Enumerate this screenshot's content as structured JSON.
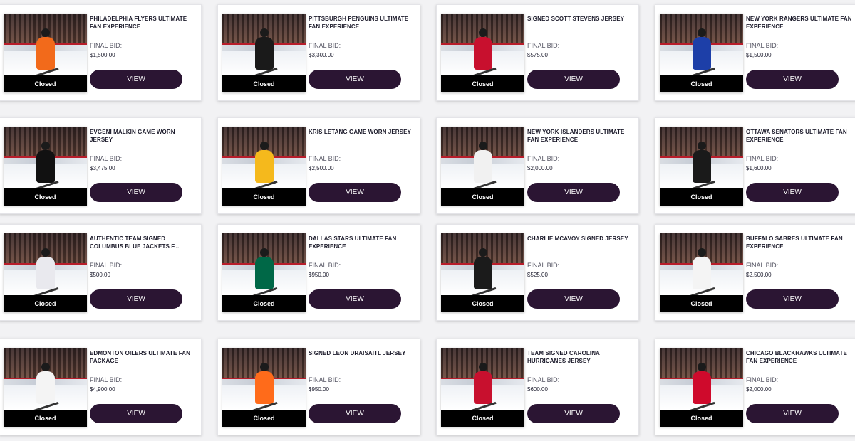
{
  "status_label": "Closed",
  "bid_label": "FINAL BID:",
  "button_label": "VIEW",
  "colors": {
    "button_bg": "#2b1533",
    "status_bg": "#000000",
    "card_bg": "#ffffff"
  },
  "items": [
    {
      "title": "PHILADELPHIA FLYERS ULTIMATE FAN EXPERIENCE",
      "final_bid": "$1,500.00",
      "jersey": "#f26a1b",
      "bg": "#ffffff"
    },
    {
      "title": "PITTSBURGH PENGUINS ULTIMATE FAN EXPERIENCE",
      "final_bid": "$3,300.00",
      "jersey": "#1a1a1a",
      "bg": "#f2b518"
    },
    {
      "title": "SIGNED SCOTT STEVENS JERSEY",
      "final_bid": "$575.00",
      "jersey": "#c8102e",
      "bg": "#e8e6e2"
    },
    {
      "title": "NEW YORK RANGERS ULTIMATE FAN EXPERIENCE",
      "final_bid": "$1,500.00",
      "jersey": "#1d3fa8",
      "bg": "#ffffff"
    },
    {
      "title": "EVGENI MALKIN GAME WORN JERSEY",
      "final_bid": "$3,475.00",
      "jersey": "#111111",
      "bg": "#f2b518"
    },
    {
      "title": "KRIS LETANG GAME WORN JERSEY",
      "final_bid": "$2,500.00",
      "jersey": "#f5b91c",
      "bg": "#dcdcdc"
    },
    {
      "title": "NEW YORK ISLANDERS ULTIMATE FAN EXPERIENCE",
      "final_bid": "$2,000.00",
      "jersey": "#f1f1f1",
      "bg": "#ffffff"
    },
    {
      "title": "OTTAWA SENATORS ULTIMATE FAN EXPERIENCE",
      "final_bid": "$1,600.00",
      "jersey": "#1a1a1a",
      "bg": "#ffffff"
    },
    {
      "title": "AUTHENTIC TEAM SIGNED COLUMBUS BLUE JACKETS F...",
      "final_bid": "$500.00",
      "jersey": "#e9e9ee",
      "bg": "#ffffff"
    },
    {
      "title": "DALLAS STARS ULTIMATE FAN EXPERIENCE",
      "final_bid": "$950.00",
      "jersey": "#006847",
      "bg": "#ffffff"
    },
    {
      "title": "CHARLIE MCAVOY SIGNED JERSEY",
      "final_bid": "$525.00",
      "jersey": "#1b1b1b",
      "bg": "#1b1b1b"
    },
    {
      "title": "BUFFALO SABRES ULTIMATE FAN EXPERIENCE",
      "final_bid": "$2,500.00",
      "jersey": "#f4f4f4",
      "bg": "#ffffff"
    },
    {
      "title": "EDMONTON OILERS ULTIMATE FAN PACKAGE",
      "final_bid": "$4,900.00",
      "jersey": "#f4f4f4",
      "bg": "#ffffff"
    },
    {
      "title": "SIGNED LEON DRAISAITL JERSEY",
      "final_bid": "$950.00",
      "jersey": "#ff6b1a",
      "bg": "#d9571d"
    },
    {
      "title": "TEAM SIGNED CAROLINA HURRICANES JERSEY",
      "final_bid": "$600.00",
      "jersey": "#c8102e",
      "bg": "#ffffff"
    },
    {
      "title": "CHICAGO BLACKHAWKS ULTIMATE FAN EXPERIENCE",
      "final_bid": "$2,000.00",
      "jersey": "#cf0a2c",
      "bg": "#ffffff"
    }
  ]
}
